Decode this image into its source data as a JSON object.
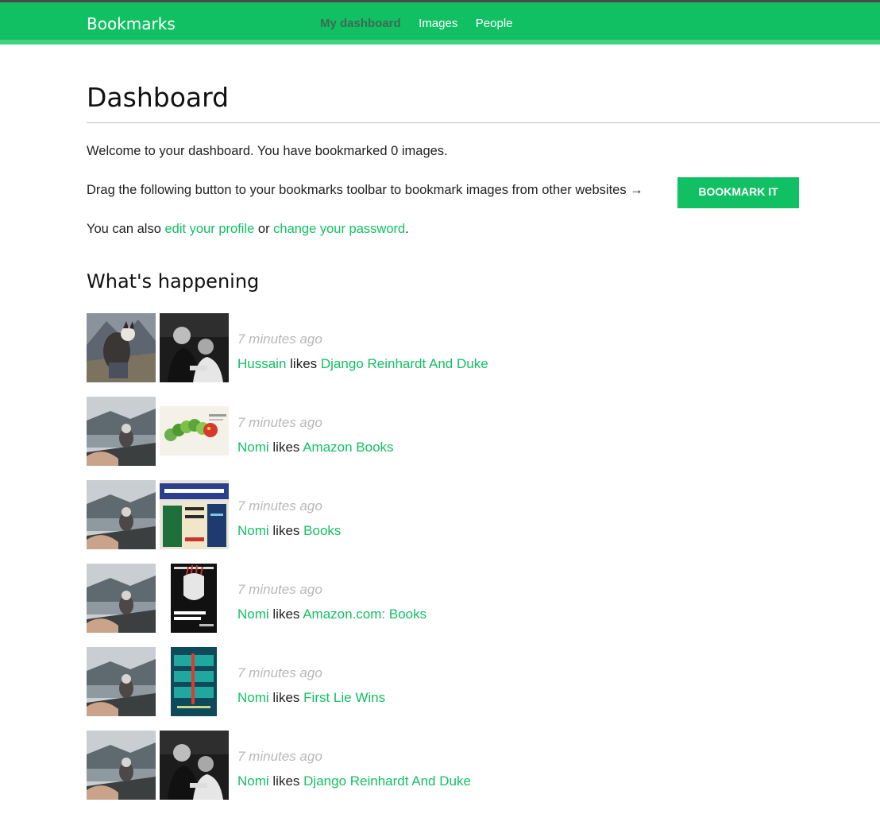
{
  "header": {
    "logo": "Bookmarks",
    "nav": [
      {
        "label": "My dashboard",
        "selected": true
      },
      {
        "label": "Images",
        "selected": false
      },
      {
        "label": "People",
        "selected": false
      }
    ]
  },
  "page": {
    "title": "Dashboard",
    "welcome": "Welcome to your dashboard. You have bookmarked 0 images.",
    "drag_text": "Drag the following button to your bookmarks toolbar to bookmark images from other websites →",
    "bookmark_button": "BOOKMARK IT",
    "also_prefix": "You can also",
    "edit_profile": "edit your profile",
    "or": "or",
    "change_password": "change your password",
    "period": "."
  },
  "activity": {
    "heading": "What's happening",
    "items": [
      {
        "time": "7 minutes ago",
        "user": "Hussain",
        "verb": "likes",
        "target": "Django Reinhardt And Duke",
        "user_img": "husky-mountain",
        "target_img": "bw-photo"
      },
      {
        "time": "7 minutes ago",
        "user": "Nomi",
        "verb": "likes",
        "target": "Amazon Books",
        "user_img": "husky-lake",
        "target_img": "caterpillar-book"
      },
      {
        "time": "7 minutes ago",
        "user": "Nomi",
        "verb": "likes",
        "target": "Books",
        "user_img": "husky-lake",
        "target_img": "best-books-cover"
      },
      {
        "time": "7 minutes ago",
        "user": "Nomi",
        "verb": "likes",
        "target": "Amazon.com: Books",
        "user_img": "husky-lake",
        "target_img": "indoctrinated-brain-cover"
      },
      {
        "time": "7 minutes ago",
        "user": "Nomi",
        "verb": "likes",
        "target": "First Lie Wins",
        "user_img": "husky-lake",
        "target_img": "first-lie-wins-cover"
      },
      {
        "time": "7 minutes ago",
        "user": "Nomi",
        "verb": "likes",
        "target": "Django Reinhardt And Duke",
        "user_img": "husky-lake",
        "target_img": "bw-photo"
      }
    ]
  },
  "colors": {
    "brand": "#12c064",
    "nav_selected": "#3d6b4f",
    "muted": "#b8b8b8"
  }
}
